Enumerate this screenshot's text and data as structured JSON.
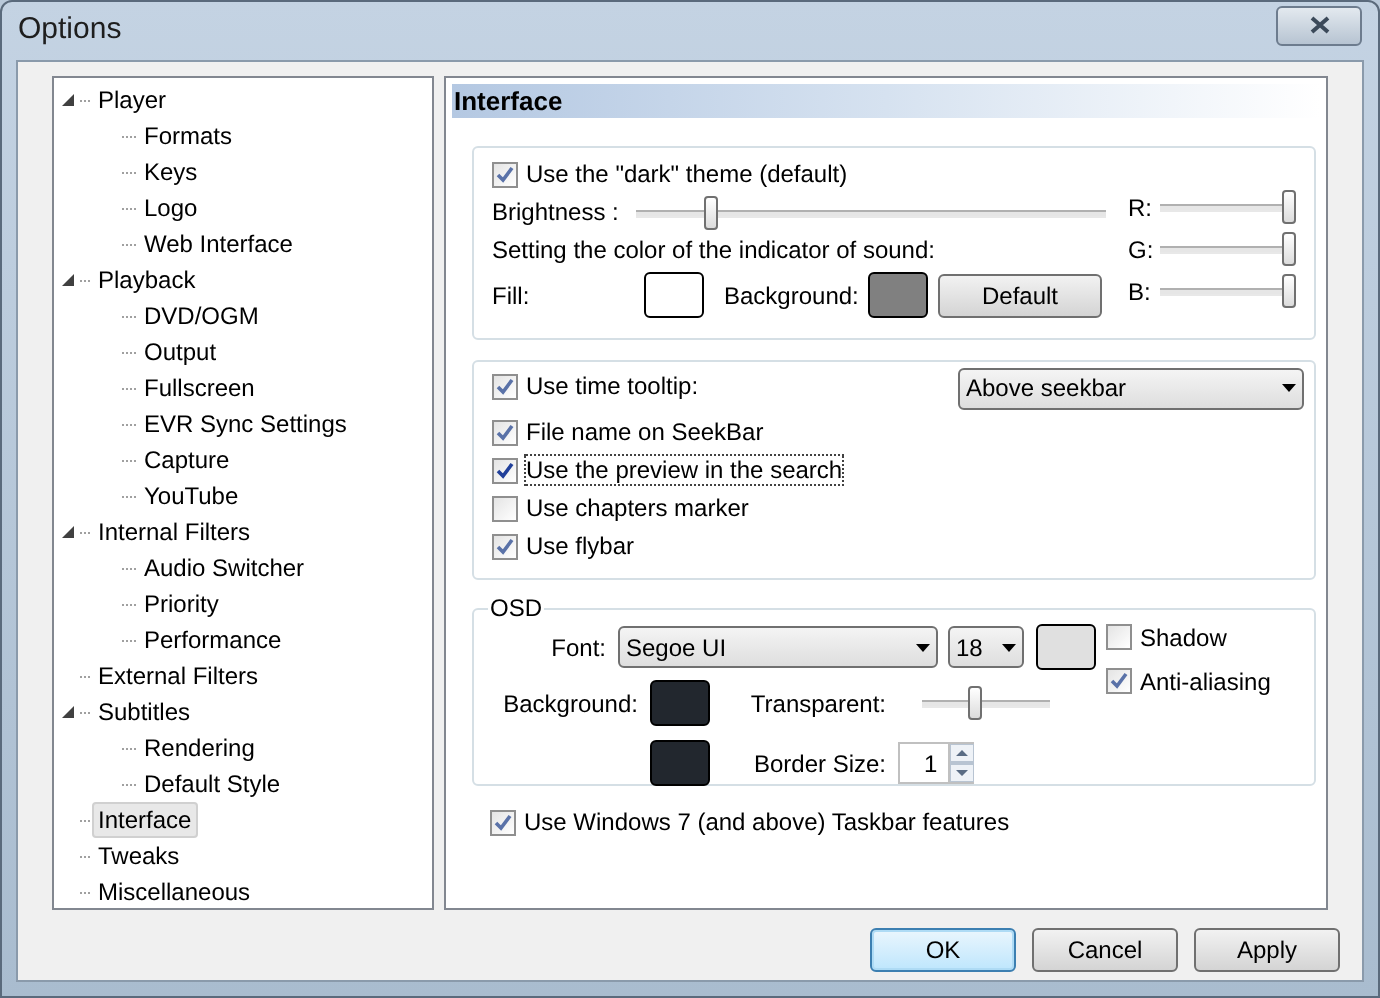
{
  "window": {
    "title": "Options"
  },
  "tree": [
    {
      "label": "Player",
      "expanded": true,
      "selected": false,
      "children": [
        {
          "label": "Formats",
          "selected": false
        },
        {
          "label": "Keys",
          "selected": false
        },
        {
          "label": "Logo",
          "selected": false
        },
        {
          "label": "Web Interface",
          "selected": false
        }
      ]
    },
    {
      "label": "Playback",
      "expanded": true,
      "selected": false,
      "children": [
        {
          "label": "DVD/OGM",
          "selected": false
        },
        {
          "label": "Output",
          "selected": false
        },
        {
          "label": "Fullscreen",
          "selected": false
        },
        {
          "label": "EVR Sync Settings",
          "selected": false
        },
        {
          "label": "Capture",
          "selected": false
        },
        {
          "label": "YouTube",
          "selected": false
        }
      ]
    },
    {
      "label": "Internal Filters",
      "expanded": true,
      "selected": false,
      "children": [
        {
          "label": "Audio Switcher",
          "selected": false
        },
        {
          "label": "Priority",
          "selected": false
        },
        {
          "label": "Performance",
          "selected": false
        }
      ]
    },
    {
      "label": "External Filters",
      "selected": false
    },
    {
      "label": "Subtitles",
      "expanded": true,
      "selected": false,
      "children": [
        {
          "label": "Rendering",
          "selected": false
        },
        {
          "label": "Default Style",
          "selected": false
        }
      ]
    },
    {
      "label": "Interface",
      "selected": true
    },
    {
      "label": "Tweaks",
      "selected": false
    },
    {
      "label": "Miscellaneous",
      "selected": false
    }
  ],
  "page": {
    "title": "Interface",
    "theme_group": {
      "dark_theme": {
        "label": "Use the \"dark\" theme (default)",
        "checked": true
      },
      "brightness": {
        "label": "Brightness :",
        "level": 0.15
      },
      "rgb": [
        {
          "label": "R:",
          "level": 1
        },
        {
          "label": "G:",
          "level": 1
        },
        {
          "label": "B:",
          "level": 1
        }
      ],
      "indicator_caption": "Setting the color of the indicator of sound:",
      "fill": {
        "label": "Fill:",
        "color": "#ffffff"
      },
      "background": {
        "label": "Background:",
        "color": "#808080"
      },
      "default_button": "Default"
    },
    "options": [
      {
        "label": "Use time tooltip:",
        "checked": true,
        "focused": false
      },
      {
        "label": "File name on SeekBar",
        "checked": true,
        "focused": false
      },
      {
        "label": "Use the preview in the search",
        "checked": true,
        "focused": true
      },
      {
        "label": "Use chapters marker",
        "checked": false,
        "focused": false
      },
      {
        "label": "Use flybar",
        "checked": true,
        "focused": false
      }
    ],
    "tooltip_position": "Above seekbar",
    "osd": {
      "title": "OSD",
      "font_label": "Font:",
      "font": "Segoe UI",
      "size": "18",
      "text_swatch": {
        "color": "#e0e0e0"
      },
      "shadow": {
        "label": "Shadow",
        "checked": false
      },
      "anti_aliasing": {
        "label": "Anti-aliasing",
        "checked": true
      },
      "background_label": "Background:",
      "background_swatch": {
        "color": "#22272e"
      },
      "transparent": {
        "label": "Transparent:",
        "level": 0.4
      },
      "border_swatch": {
        "color": "#22272e"
      },
      "border_size_label": "Border Size:",
      "border_size": "1"
    },
    "taskbar": {
      "label": "Use Windows 7 (and above) Taskbar features",
      "checked": true
    }
  },
  "buttons": [
    {
      "label": "OK",
      "default": true
    },
    {
      "label": "Cancel",
      "default": false
    },
    {
      "label": "Apply",
      "default": false
    }
  ]
}
